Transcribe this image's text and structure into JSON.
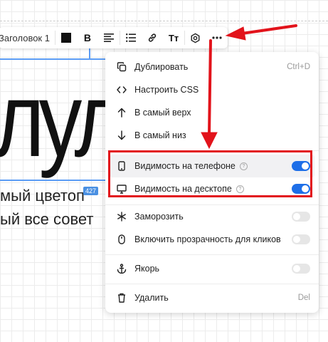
{
  "toolbar": {
    "heading_style": "Заголовок 1",
    "text_color": "#111111",
    "bold_label": "B",
    "text_case_label": "Tт",
    "icons": [
      "text-color-icon",
      "bold-icon",
      "align-icon",
      "list-icon",
      "link-icon",
      "text-case-icon",
      "settings-icon",
      "more-icon"
    ]
  },
  "canvas": {
    "big_text": "лулі",
    "line1": "мый цвето",
    "line1_suffix": "п",
    "line2": "ый все совет",
    "size_badge": "427"
  },
  "menu": {
    "duplicate": {
      "label": "Дублировать",
      "shortcut": "Ctrl+D"
    },
    "css": {
      "label": "Настроить CSS"
    },
    "to_top": {
      "label": "В самый верх"
    },
    "to_bottom": {
      "label": "В самый низ"
    },
    "mobile_visibility": {
      "label": "Видимость на телефоне",
      "enabled": true
    },
    "desktop_visibility": {
      "label": "Видимость на десктопе",
      "enabled": true
    },
    "freeze": {
      "label": "Заморозить",
      "enabled": false
    },
    "click_through": {
      "label": "Включить прозрачность для кликов",
      "enabled": false
    },
    "anchor": {
      "label": "Якорь",
      "enabled": false
    },
    "delete": {
      "label": "Удалить",
      "shortcut": "Del"
    }
  },
  "colors": {
    "accent": "#1e6fe8",
    "annotation": "#e2131b",
    "selection": "#5b9cf5"
  }
}
